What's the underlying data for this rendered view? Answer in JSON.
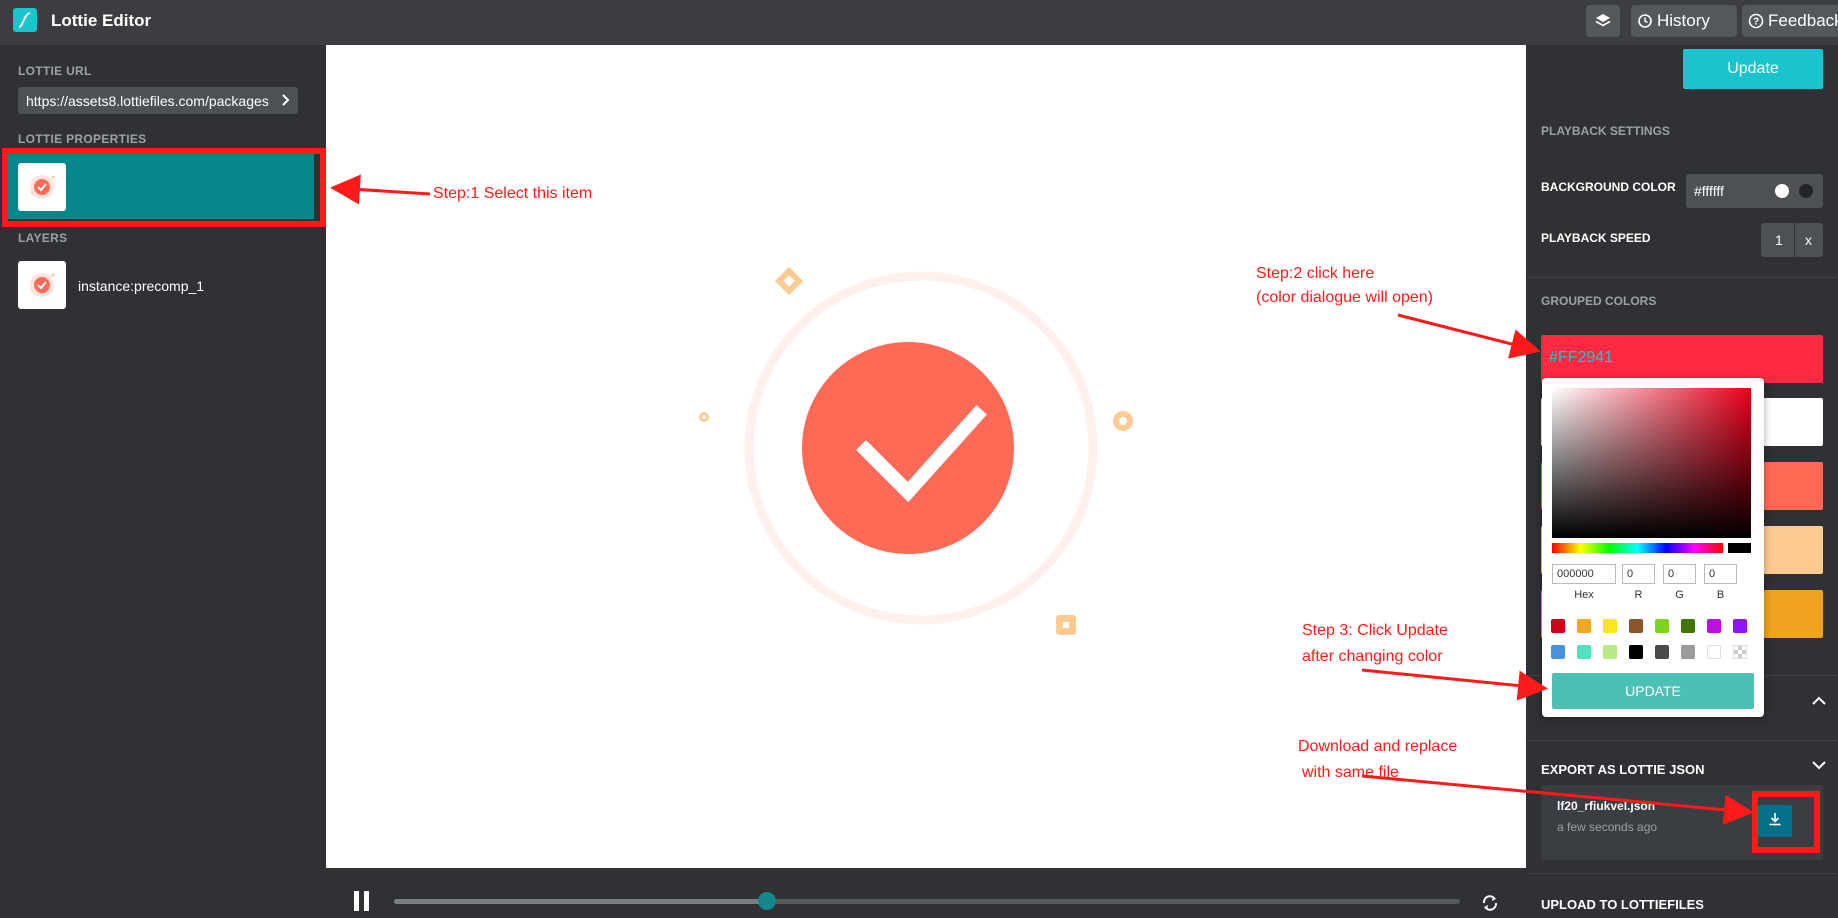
{
  "topbar": {
    "app_title": "Lottie Editor",
    "layers_button_icon": "layers-icon",
    "history_label": "History",
    "feedback_label": "Feedback"
  },
  "left": {
    "url_label": "LOTTIE URL",
    "url_value": "https://assets8.lottiefiles.com/packages",
    "properties_label": "LOTTIE PROPERTIES",
    "layers_label": "LAYERS",
    "layer_name": "instance:precomp_1"
  },
  "right": {
    "update_label": "Update",
    "playback_settings_label": "PLAYBACK SETTINGS",
    "background_color_label": "BACKGROUND COLOR",
    "background_color_value": "#ffffff",
    "playback_speed_label": "PLAYBACK SPEED",
    "playback_speed_value": "1",
    "playback_speed_unit": "x",
    "grouped_colors_label": "GROUPED COLORS",
    "grouped_color_1_text": "#FF2941",
    "grouped_colors": [
      "#ff2941",
      "#ffffff",
      "#ff6a57",
      "#ffcb93",
      "#efa321"
    ],
    "export_label": "EXPORT AS LOTTIE JSON",
    "export_file_name": "lf20_rfiukvel.json",
    "export_file_time": "a few seconds ago",
    "upload_label": "UPLOAD TO LOTTIEFILES"
  },
  "picker": {
    "hex_value": "000000",
    "r_value": "0",
    "g_value": "0",
    "b_value": "0",
    "hex_label": "Hex",
    "r_label": "R",
    "g_label": "G",
    "b_label": "B",
    "update_label": "UPDATE",
    "swatches": [
      "#d0021b",
      "#f5a623",
      "#f8e71c",
      "#8b572a",
      "#7ed321",
      "#417505",
      "#bd10e0",
      "#9013fe",
      "#4a90e2",
      "#50e3c2",
      "#b8e986",
      "#000000",
      "#4a4a4a",
      "#9b9b9b",
      "#ffffff",
      "transparent"
    ]
  },
  "animation": {
    "accent_color": "#ff6a57",
    "ring_color": "#fff0ee",
    "confetti_color": "#ffcb93",
    "playback_progress": 0.35
  },
  "annotations": {
    "step1": "Step:1 Select this item",
    "step2_line1": "Step:2 click here",
    "step2_line2": "(color dialogue will open)",
    "step3_line1": "Step 3: Click Update",
    "step3_line2": "after changing color",
    "step4_line1": "Download and replace",
    "step4_line2": "with same file"
  }
}
